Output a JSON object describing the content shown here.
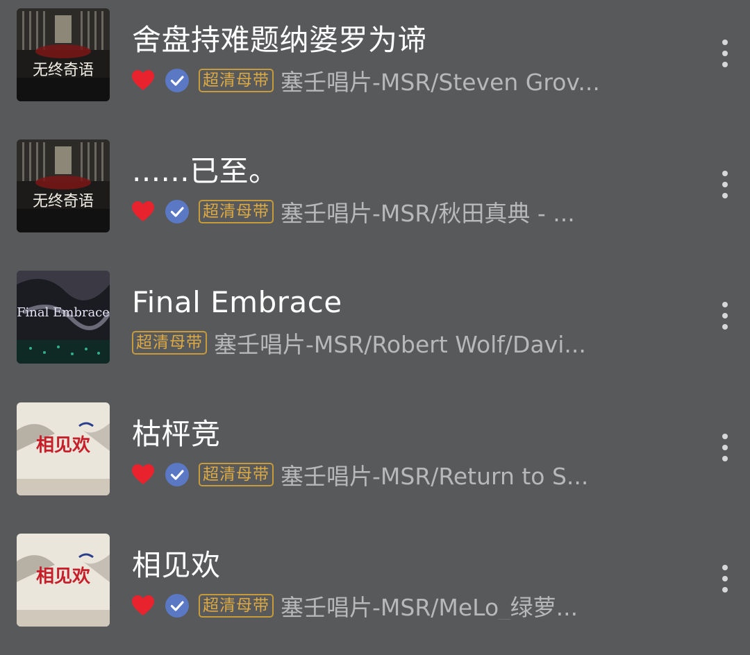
{
  "colors": {
    "background": "#57595b",
    "title": "#ffffff",
    "artist": "#b6b8ba",
    "badge": "#dca944",
    "heart": "#e8232e",
    "check": "#5a78c4"
  },
  "songs": [
    {
      "title": "舍盘持难题纳婆罗为谛",
      "liked": true,
      "verified": true,
      "badge": "超清母带",
      "artist": "塞壬唱片-MSR/Steven Grov...",
      "cover": "album-cover-wuzhongqiyu",
      "cover_text": "无终奇语"
    },
    {
      "title": "......已至。",
      "liked": true,
      "verified": true,
      "badge": "超清母带",
      "artist": "塞壬唱片-MSR/秋田真典 - ...",
      "cover": "album-cover-wuzhongqiyu",
      "cover_text": "无终奇语"
    },
    {
      "title": "Final Embrace",
      "liked": false,
      "verified": false,
      "badge": "超清母带",
      "artist": "塞壬唱片-MSR/Robert Wolf/Davi...",
      "cover": "album-cover-final-embrace",
      "cover_text": "Final Embrace"
    },
    {
      "title": "枯枰竞",
      "liked": true,
      "verified": true,
      "badge": "超清母带",
      "artist": "塞壬唱片-MSR/Return to S...",
      "cover": "album-cover-xiangjianhuan",
      "cover_text": "相见欢"
    },
    {
      "title": "相见欢",
      "liked": true,
      "verified": true,
      "badge": "超清母带",
      "artist": "塞壬唱片-MSR/MeLo_绿萝...",
      "cover": "album-cover-xiangjianhuan",
      "cover_text": "相见欢"
    }
  ]
}
